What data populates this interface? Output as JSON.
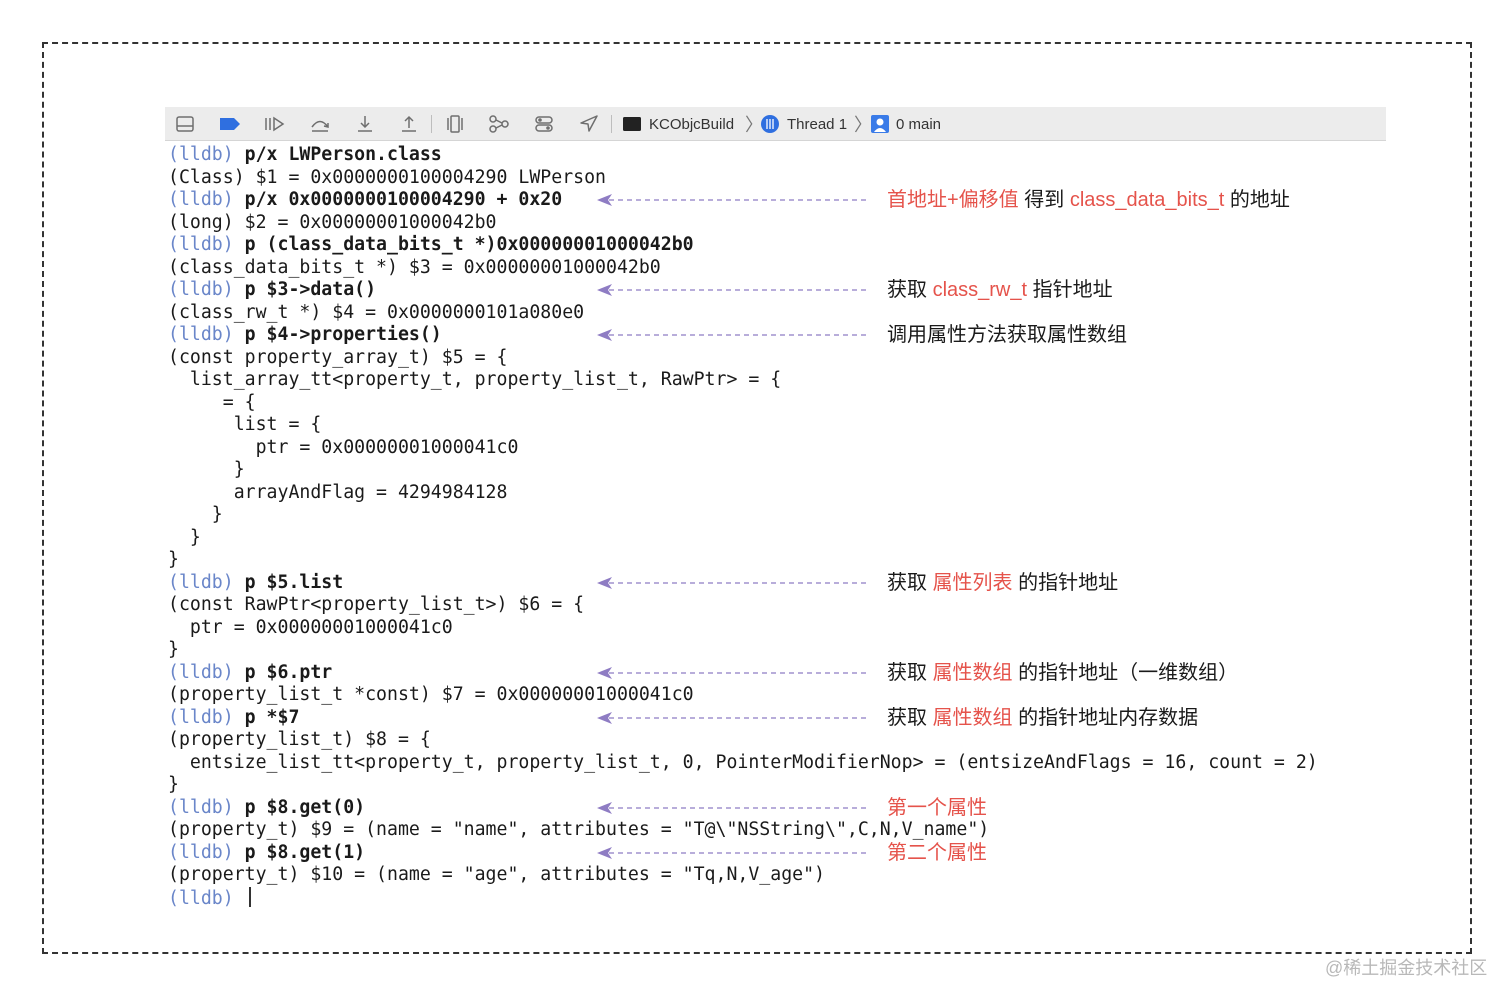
{
  "toolbar": {
    "buttons": [
      {
        "name": "hide-debug-area-icon"
      },
      {
        "name": "breakpoints-toggle-icon"
      },
      {
        "name": "continue-icon"
      },
      {
        "name": "step-over-icon"
      },
      {
        "name": "step-into-icon"
      },
      {
        "name": "step-out-icon"
      },
      {
        "name": "view-debugger-icon"
      },
      {
        "name": "memory-graph-icon"
      },
      {
        "name": "environment-overrides-icon"
      },
      {
        "name": "simulate-location-icon"
      }
    ],
    "breadcrumb": {
      "project": "KCObjcBuild",
      "thread": "Thread 1",
      "frame": "0 main"
    }
  },
  "console": {
    "prompt": "(lldb)",
    "lines": [
      {
        "prompt": true,
        "text": "p/x LWPerson.class"
      },
      {
        "prompt": false,
        "text": "(Class) $1 = 0x0000000100004290 LWPerson"
      },
      {
        "prompt": true,
        "text": "p/x 0x0000000100004290 + 0x20"
      },
      {
        "prompt": false,
        "text": "(long) $2 = 0x00000001000042b0"
      },
      {
        "prompt": true,
        "text": "p (class_data_bits_t *)0x00000001000042b0"
      },
      {
        "prompt": false,
        "text": "(class_data_bits_t *) $3 = 0x00000001000042b0"
      },
      {
        "prompt": true,
        "text": "p $3->data()"
      },
      {
        "prompt": false,
        "text": "(class_rw_t *) $4 = 0x0000000101a080e0"
      },
      {
        "prompt": true,
        "text": "p $4->properties()"
      },
      {
        "prompt": false,
        "text": "(const property_array_t) $5 = {"
      },
      {
        "prompt": false,
        "text": "  list_array_tt<property_t, property_list_t, RawPtr> = {"
      },
      {
        "prompt": false,
        "text": "     = {"
      },
      {
        "prompt": false,
        "text": "      list = {"
      },
      {
        "prompt": false,
        "text": "        ptr = 0x00000001000041c0"
      },
      {
        "prompt": false,
        "text": "      }"
      },
      {
        "prompt": false,
        "text": "      arrayAndFlag = 4294984128"
      },
      {
        "prompt": false,
        "text": "    }"
      },
      {
        "prompt": false,
        "text": "  }"
      },
      {
        "prompt": false,
        "text": "}"
      },
      {
        "prompt": true,
        "text": "p $5.list"
      },
      {
        "prompt": false,
        "text": "(const RawPtr<property_list_t>) $6 = {"
      },
      {
        "prompt": false,
        "text": "  ptr = 0x00000001000041c0"
      },
      {
        "prompt": false,
        "text": "}"
      },
      {
        "prompt": true,
        "text": "p $6.ptr"
      },
      {
        "prompt": false,
        "text": "(property_list_t *const) $7 = 0x00000001000041c0"
      },
      {
        "prompt": true,
        "text": "p *$7"
      },
      {
        "prompt": false,
        "text": "(property_list_t) $8 = {"
      },
      {
        "prompt": false,
        "text": "  entsize_list_tt<property_t, property_list_t, 0, PointerModifierNop> = (entsizeAndFlags = 16, count = 2)"
      },
      {
        "prompt": false,
        "text": "}"
      },
      {
        "prompt": true,
        "text": "p $8.get(0)"
      },
      {
        "prompt": false,
        "text": "(property_t) $9 = (name = \"name\", attributes = \"T@\\\"NSString\\\",C,N,V_name\")"
      },
      {
        "prompt": true,
        "text": "p $8.get(1)"
      },
      {
        "prompt": false,
        "text": "(property_t) $10 = (name = \"age\", attributes = \"Tq,N,V_age\")"
      },
      {
        "prompt": true,
        "text": "",
        "cursor": true
      }
    ]
  },
  "annotations": [
    {
      "line": 2,
      "parts": [
        {
          "t": "首地址+偏移值",
          "hl": true
        },
        {
          "t": " 得到 ",
          "hl": false
        },
        {
          "t": "class_data_bits_t",
          "hl": true
        },
        {
          "t": " 的地址",
          "hl": false
        }
      ]
    },
    {
      "line": 6,
      "parts": [
        {
          "t": "获取 ",
          "hl": false
        },
        {
          "t": "class_rw_t",
          "hl": true
        },
        {
          "t": " 指针地址",
          "hl": false
        }
      ]
    },
    {
      "line": 8,
      "parts": [
        {
          "t": "调用属性方法获取属性数组",
          "hl": false
        }
      ]
    },
    {
      "line": 19,
      "parts": [
        {
          "t": "获取 ",
          "hl": false
        },
        {
          "t": "属性列表",
          "hl": true
        },
        {
          "t": " 的指针地址",
          "hl": false
        }
      ]
    },
    {
      "line": 23,
      "parts": [
        {
          "t": "获取 ",
          "hl": false
        },
        {
          "t": "属性数组",
          "hl": true
        },
        {
          "t": " 的指针地址（一维数组）",
          "hl": false
        }
      ]
    },
    {
      "line": 25,
      "parts": [
        {
          "t": "获取 ",
          "hl": false
        },
        {
          "t": "属性数组",
          "hl": true
        },
        {
          "t": " 的指针地址内存数据",
          "hl": false
        }
      ]
    },
    {
      "line": 29,
      "parts": [
        {
          "t": "第一个属性",
          "hl": true
        }
      ]
    },
    {
      "line": 31,
      "parts": [
        {
          "t": "第二个属性",
          "hl": true
        }
      ]
    }
  ],
  "colors": {
    "prompt": "#6a86c9",
    "highlight": "#e5534b",
    "arrow": "#8e7cc3",
    "toolbar_icon": "#6e6e6e",
    "accent_blue": "#2f6fe0"
  },
  "watermark": "@稀土掘金技术社区"
}
